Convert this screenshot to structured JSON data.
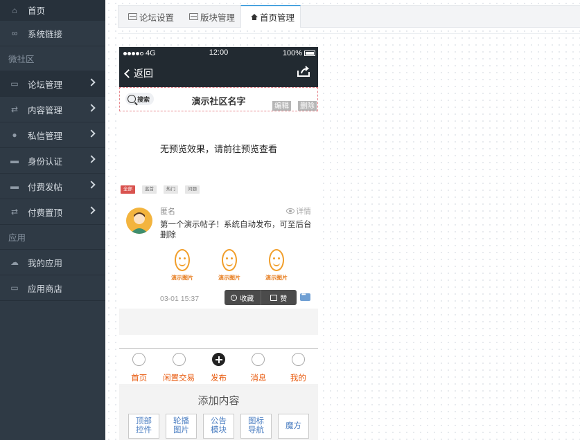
{
  "sidebar": {
    "items": [
      {
        "label": "首页"
      },
      {
        "label": "系统链接"
      }
    ],
    "group1": "微社区",
    "community_items": [
      {
        "label": "论坛管理"
      },
      {
        "label": "内容管理"
      },
      {
        "label": "私信管理"
      },
      {
        "label": "身份认证"
      },
      {
        "label": "付费发帖"
      },
      {
        "label": "付费置顶"
      }
    ],
    "group2": "应用",
    "app_items": [
      {
        "label": "我的应用"
      },
      {
        "label": "应用商店"
      }
    ]
  },
  "tabs": [
    {
      "label": "论坛设置"
    },
    {
      "label": "版块管理"
    },
    {
      "label": "首页管理"
    }
  ],
  "phone": {
    "status": {
      "carrier": "4G",
      "time": "12:00",
      "battery": "100%"
    },
    "nav": {
      "back": "返回"
    },
    "topbar": {
      "search": "搜索",
      "title": "演示社区名字",
      "edit": "编辑",
      "delete": "删除"
    },
    "preview_message": "无预览效果，请前往预览查看",
    "filters": [
      "全部",
      "蓝首",
      "热门",
      "问题"
    ],
    "post": {
      "author": "匿名",
      "detail": "详情",
      "text": "第一个演示帖子！系统自动发布，可至后台删除",
      "images": [
        "演示图片",
        "演示图片",
        "演示图片"
      ],
      "date": "03-01 15:37",
      "actions": {
        "favorite": "收藏",
        "like": "赞"
      }
    },
    "tabbar": [
      {
        "label": "首页"
      },
      {
        "label": "闲置交易"
      },
      {
        "label": "发布"
      },
      {
        "label": "消息"
      },
      {
        "label": "我的"
      }
    ],
    "add_section": {
      "title": "添加内容",
      "buttons": [
        "顶部\n控件",
        "轮播\n图片",
        "公告\n模块",
        "图标\n导航",
        "魔方"
      ]
    }
  },
  "colors": {
    "sidebar_bg": "#2f3a45",
    "accent_tab": "#4aa3df",
    "tab_label": "#e8590c",
    "danger": "#d9534f"
  }
}
